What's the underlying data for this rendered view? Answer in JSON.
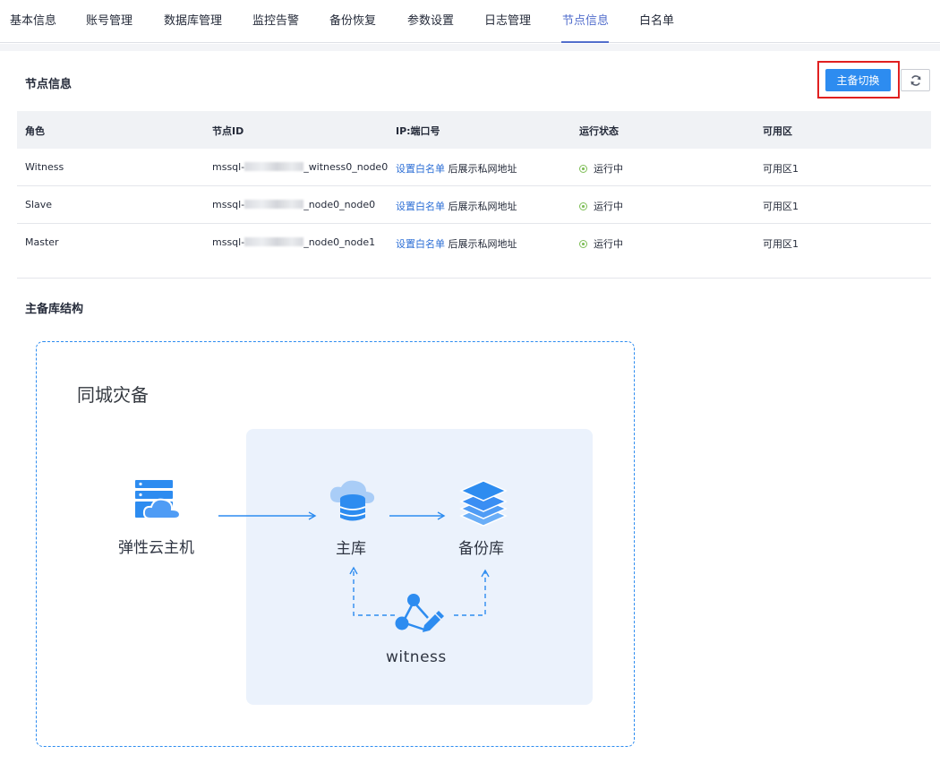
{
  "tabs": [
    {
      "label": "基本信息"
    },
    {
      "label": "账号管理"
    },
    {
      "label": "数据库管理"
    },
    {
      "label": "监控告警"
    },
    {
      "label": "备份恢复"
    },
    {
      "label": "参数设置"
    },
    {
      "label": "日志管理"
    },
    {
      "label": "节点信息",
      "active": true
    },
    {
      "label": "白名单"
    }
  ],
  "node_section": {
    "title": "节点信息",
    "switch_button": "主备切换",
    "refresh_icon": "refresh-icon"
  },
  "table": {
    "headers": [
      "角色",
      "节点ID",
      "IP:端口号",
      "运行状态",
      "可用区"
    ],
    "rows": [
      {
        "role": "Witness",
        "id_prefix": "mssql-",
        "id_suffix": "_witness0_node0",
        "ip_link": "设置白名单",
        "ip_text": "后展示私网地址",
        "status": "运行中",
        "zone": "可用区1"
      },
      {
        "role": "Slave",
        "id_prefix": "mssql-",
        "id_suffix": "_node0_node0",
        "ip_link": "设置白名单",
        "ip_text": "后展示私网地址",
        "status": "运行中",
        "zone": "可用区1"
      },
      {
        "role": "Master",
        "id_prefix": "mssql-",
        "id_suffix": "_node0_node1",
        "ip_link": "设置白名单",
        "ip_text": "后展示私网地址",
        "status": "运行中",
        "zone": "可用区1"
      }
    ]
  },
  "structure_section": {
    "title": "主备库结构"
  },
  "diagram": {
    "title": "同城灾备",
    "ecs_label": "弹性云主机",
    "primary_label": "主库",
    "backup_label": "备份库",
    "witness_label": "witness"
  },
  "colors": {
    "accent": "#2d8cf0",
    "status_ok": "#7fbe58",
    "highlight_border": "#e02020"
  }
}
